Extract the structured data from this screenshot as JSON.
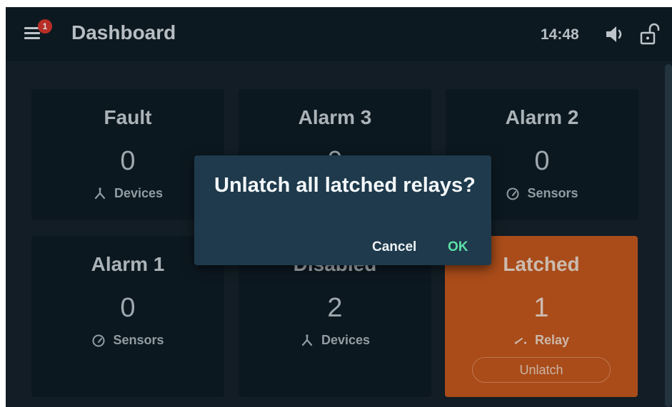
{
  "topbar": {
    "title": "Dashboard",
    "notification_count": "1",
    "time": "14:48",
    "icons": [
      "menu-icon",
      "volume-icon",
      "unlock-icon"
    ]
  },
  "cards": [
    {
      "label": "Fault",
      "count": "0",
      "sub_label": "Devices",
      "icon": "devices-icon"
    },
    {
      "label": "Alarm 3",
      "count": "0",
      "sub_label": "",
      "icon": ""
    },
    {
      "label": "Alarm 2",
      "count": "0",
      "sub_label": "Sensors",
      "icon": "sensor-gauge-icon"
    },
    {
      "label": "Alarm 1",
      "count": "0",
      "sub_label": "Sensors",
      "icon": "sensor-gauge-icon"
    },
    {
      "label": "Disabled",
      "count": "2",
      "sub_label": "Devices",
      "icon": "devices-icon"
    },
    {
      "label": "Latched",
      "count": "1",
      "sub_label": "Relay",
      "icon": "relay-icon",
      "button": "Unlatch"
    }
  ],
  "dialog": {
    "title": "Unlatch all latched relays?",
    "cancel_label": "Cancel",
    "ok_label": "OK"
  },
  "colors": {
    "background": "#152029",
    "topbar": "#0f1c24",
    "card": "#0e1b23",
    "latched_card": "#c6581c",
    "dialog": "#1e3a4c",
    "ok_accent": "#5ee0a6",
    "badge": "#d9352b"
  }
}
